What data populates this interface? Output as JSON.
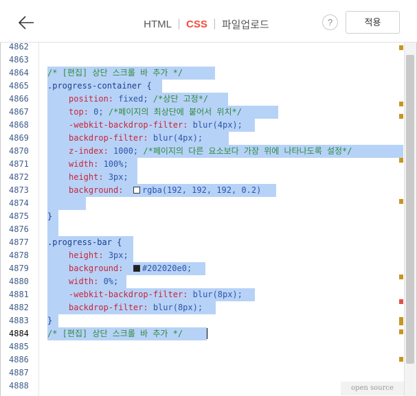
{
  "header": {
    "tabs": [
      {
        "label": "HTML",
        "active": false
      },
      {
        "label": "CSS",
        "active": true
      },
      {
        "label": "파일업로드",
        "active": false
      }
    ],
    "help_label": "?",
    "apply_label": "적용"
  },
  "editor": {
    "line_numbers": [
      "4862",
      "4863",
      "4864",
      "4865",
      "4866",
      "4867",
      "4868",
      "4869",
      "4870",
      "4871",
      "4872",
      "4873",
      "4874",
      "4875",
      "4876",
      "4877",
      "4878",
      "4879",
      "4880",
      "4881",
      "4882",
      "4883",
      "4884",
      "4885",
      "4886",
      "4887",
      "4888"
    ],
    "current_line": "4884",
    "code": {
      "c4864": "/* [편집] 상단 스크롤 바 추가 */",
      "s4865": ".progress-container {",
      "p4866": "position",
      "v4866": " fixed;",
      "c4866": " /*상단 고정*/",
      "p4867": "top",
      "v4867": " 0;",
      "c4867": " /*페이지의 최상단에 붙어서 위치*/",
      "p4868": "-webkit-backdrop-filter",
      "v4868": " blur(4px);",
      "p4869": "backdrop-filter",
      "v4869": " blur(4px);",
      "p4870": "z-index",
      "v4870": " 1000;",
      "c4870": " /*페이지의 다른 요소보다 가장 위에 나타나도록 설정*/",
      "p4871": "width",
      "v4871": " 100%;",
      "p4872": "height",
      "v4872": " 3px;",
      "p4873": "background",
      "v4873": "rgba(192, 192, 192, 0.2)",
      "s4875": "}",
      "s4877": ".progress-bar {",
      "p4878": "height",
      "v4878": " 3px;",
      "p4879": "background",
      "v4879": "#202020e0;",
      "p4880": "width",
      "v4880": " 0%;",
      "p4881": "-webkit-backdrop-filter",
      "v4881": " blur(8px);",
      "p4882": "backdrop-filter",
      "v4882": " blur(8px);",
      "s4883": "}",
      "c4884": "/* [편집] 상단 스크롤 바 추가 */"
    },
    "colon": ":",
    "swatch_colors": {
      "light": "#ffffff",
      "dark": "#202020"
    }
  },
  "footer": {
    "badge_label": "open source"
  },
  "colors": {
    "accent": "#f24b3d",
    "selection": "#b7d2f7",
    "marker": "#c8951e",
    "marker_red": "#e0524a"
  }
}
